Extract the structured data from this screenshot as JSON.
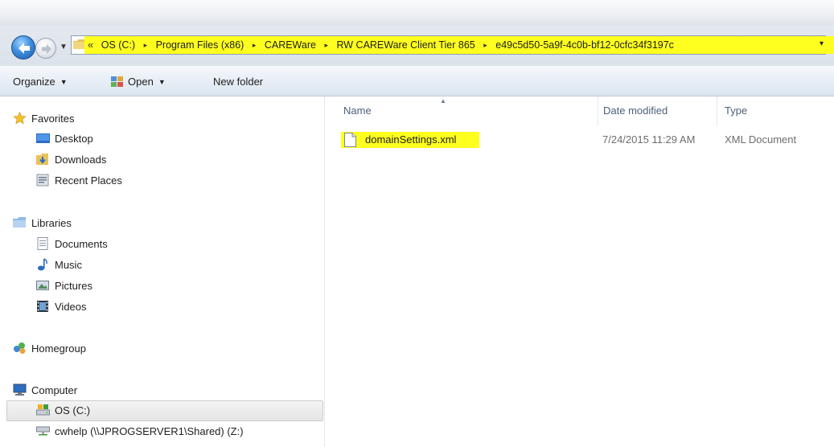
{
  "address_bar": {
    "overflow_chevron": "«",
    "crumbs": [
      "OS (C:)",
      "Program Files (x86)",
      "CAREWare",
      "RW CAREWare Client Tier 865",
      "e49c5d50-5a9f-4c0b-bf12-0cfc34f3197c"
    ],
    "separator": "▸",
    "dropdown": "▾",
    "highlight_color": "#ffff1f"
  },
  "toolbar": {
    "organize_label": "Organize",
    "open_label": "Open",
    "new_folder_label": "New folder",
    "dropdown_arrow": "▼"
  },
  "nav_pane": {
    "favorites": {
      "label": "Favorites",
      "items": [
        {
          "label": "Desktop",
          "icon": "desktop-icon"
        },
        {
          "label": "Downloads",
          "icon": "downloads-icon"
        },
        {
          "label": "Recent Places",
          "icon": "recent-places-icon"
        }
      ]
    },
    "libraries": {
      "label": "Libraries",
      "items": [
        {
          "label": "Documents",
          "icon": "documents-icon"
        },
        {
          "label": "Music",
          "icon": "music-icon"
        },
        {
          "label": "Pictures",
          "icon": "pictures-icon"
        },
        {
          "label": "Videos",
          "icon": "videos-icon"
        }
      ]
    },
    "homegroup": {
      "label": "Homegroup"
    },
    "computer": {
      "label": "Computer",
      "items": [
        {
          "label": "OS (C:)",
          "icon": "drive-icon",
          "selected": true
        },
        {
          "label": "cwhelp (\\\\JPROGSERVER1\\Shared) (Z:)",
          "icon": "network-drive-icon"
        }
      ]
    }
  },
  "file_list": {
    "columns": {
      "name": "Name",
      "date_modified": "Date modified",
      "type": "Type"
    },
    "sort_indicator": "▲",
    "rows": [
      {
        "name": "domainSettings.xml",
        "date_modified": "7/24/2015 11:29 AM",
        "type": "XML Document",
        "highlighted": true
      }
    ]
  },
  "colors": {
    "highlight": "#ffff1f",
    "header_text": "#4c607a",
    "accent_blue": "#3e8fdc"
  }
}
